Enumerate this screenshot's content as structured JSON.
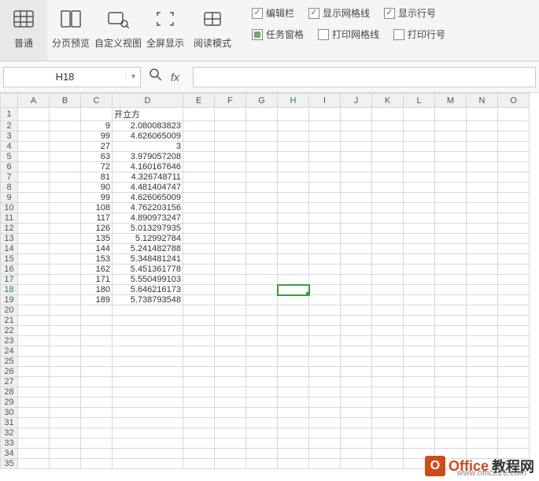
{
  "ribbon": {
    "normal": "普通",
    "page_preview": "分页预览",
    "custom_view": "自定义视图",
    "fullscreen": "全屏显示",
    "read_mode": "阅读模式"
  },
  "checks": {
    "edit_bar": "编辑栏",
    "show_grid": "显示网格线",
    "show_headers": "显示行号",
    "task_pane": "任务窗格",
    "print_grid": "打印网格线",
    "print_headers": "打印行号"
  },
  "namebox": "H18",
  "fx": "fx",
  "columns": [
    "A",
    "B",
    "C",
    "D",
    "E",
    "F",
    "G",
    "H",
    "I",
    "J",
    "K",
    "L",
    "M",
    "N",
    "O"
  ],
  "header_d": "开立方",
  "data": [
    {
      "c": 9,
      "d": "2.080083823"
    },
    {
      "c": 99,
      "d": "4.626065009"
    },
    {
      "c": 27,
      "d": "3"
    },
    {
      "c": 63,
      "d": "3.979057208"
    },
    {
      "c": 72,
      "d": "4.160167646"
    },
    {
      "c": 81,
      "d": "4.326748711"
    },
    {
      "c": 90,
      "d": "4.481404747"
    },
    {
      "c": 99,
      "d": "4.626065009"
    },
    {
      "c": 108,
      "d": "4.762203156"
    },
    {
      "c": 117,
      "d": "4.890973247"
    },
    {
      "c": 126,
      "d": "5.013297935"
    },
    {
      "c": 135,
      "d": "5.12992784"
    },
    {
      "c": 144,
      "d": "5.241482788"
    },
    {
      "c": 153,
      "d": "5.348481241"
    },
    {
      "c": 162,
      "d": "5.451361778"
    },
    {
      "c": 171,
      "d": "5.550499103"
    },
    {
      "c": 180,
      "d": "5.646216173"
    },
    {
      "c": 189,
      "d": "5.738793548"
    }
  ],
  "watermark": {
    "brand1": "Office",
    "brand2": "教程网",
    "url": "www.office26.com"
  }
}
